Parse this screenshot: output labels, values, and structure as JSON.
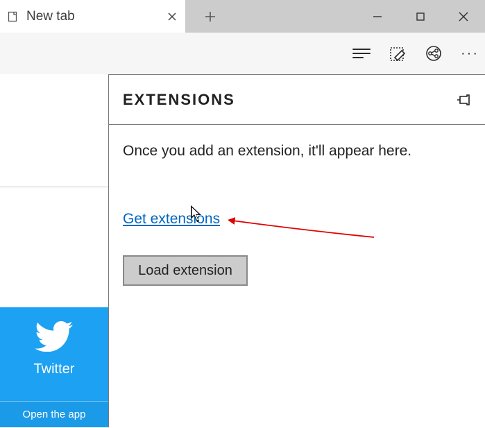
{
  "tab": {
    "title": "New tab"
  },
  "toolbar": {
    "hub_icon": "hub-icon",
    "notes_icon": "web-notes-icon",
    "share_icon": "share-icon",
    "more_icon": "more-icon"
  },
  "twitter_tile": {
    "name": "Twitter",
    "open_app": "Open the app"
  },
  "panel": {
    "title": "EXTENSIONS",
    "message": "Once you add an extension, it'll appear here.",
    "get_extensions": "Get extensions",
    "load_extension": "Load extension"
  }
}
